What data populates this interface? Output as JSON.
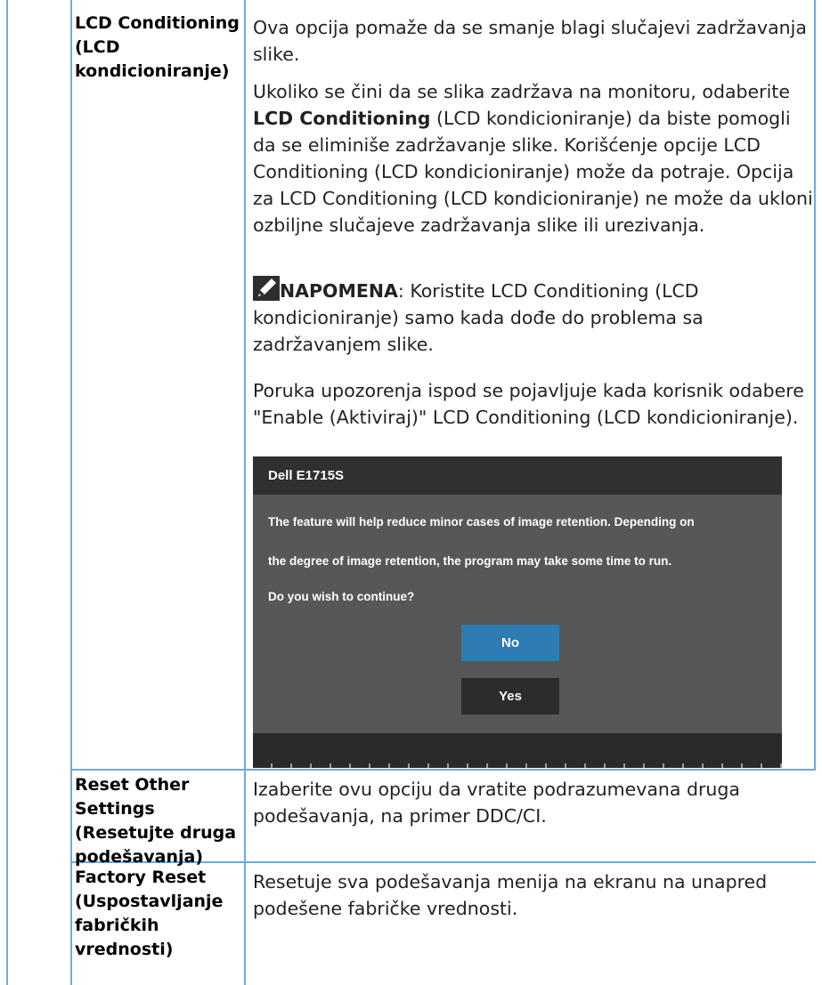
{
  "rows": [
    {
      "label": "LCD Conditioning\n(LCD\nkondicioniranje)",
      "p1": "Ova opcija pomaže da se smanje blagi slučajevi zadržavanja slike.",
      "p2_pre": "Ukoliko se čini da se slika zadržava na monitoru, odaberite ",
      "p2_bold": "LCD Conditioning",
      "p2_post": " (LCD kondicioniranje) da biste pomogli da se eliminiše zadržavanje slike. Korišćenje opcije LCD Conditioning (LCD kondicioniranje) može da potraje. Opcija za LCD Conditioning (LCD kondicioniranje) ne može da ukloni ozbiljne slučajeve zadržavanja slike ili urezivanja.",
      "note_label": "NAPOMENA",
      "note_text": ": Koristite LCD Conditioning (LCD kondicioniranje) samo kada dođe do problema sa zadržavanjem slike.",
      "p3": "Poruka upozorenja ispod se pojavljuje kada korisnik odabere \"Enable (Aktiviraj)\" LCD Conditioning (LCD kondicioniranje)."
    },
    {
      "label": "Reset Other\nSettings\n(Resetujte druga\npodešavanja)",
      "desc": "Izaberite ovu opciju da vratite podrazumevana druga podešavanja, na primer DDC/CI."
    },
    {
      "label": "Factory Reset\n(Uspostavljanje\nfabričkih\nvrednosti)",
      "desc": "Resetuje sva podešavanja menija na ekranu na unapred podešene fabričke vrednosti."
    }
  ],
  "osd": {
    "title": "Dell E1715S",
    "line1": "The feature will help reduce minor cases of image retention. Depending on",
    "line2": "the degree of image retention, the program may take some time to run.",
    "line3": "Do you wish to continue?",
    "no_label": "No",
    "yes_label": "Yes"
  },
  "icons": {
    "note": "pencil-icon"
  },
  "colors": {
    "border": "#6fa8dc",
    "no_button": "#2f7cb3",
    "osd_body": "#575757",
    "osd_header": "#303030"
  }
}
